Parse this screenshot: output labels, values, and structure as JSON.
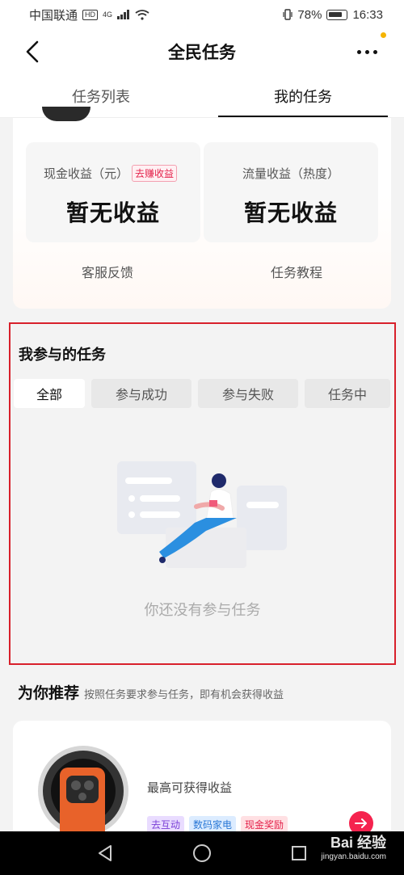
{
  "status_bar": {
    "carrier": "中国联通",
    "hd_badge": "HD",
    "network": "4G",
    "battery": "78%",
    "time": "16:33",
    "icons": [
      "signal-icon",
      "wifi-icon",
      "vibrate-icon",
      "battery-icon"
    ]
  },
  "header": {
    "title": "全民任务",
    "back_icon": "chevron-left-icon",
    "more_icon": "more-horizontal-icon"
  },
  "tabs": [
    {
      "label": "任务列表",
      "active": false
    },
    {
      "label": "我的任务",
      "active": true
    }
  ],
  "summary": {
    "cash": {
      "label": "现金收益（元）",
      "tag": "去赚收益",
      "value": "暂无收益"
    },
    "traffic": {
      "label": "流量收益（热度）",
      "value": "暂无收益"
    },
    "links": [
      "客服反馈",
      "任务教程"
    ]
  },
  "participated": {
    "title": "我参与的任务",
    "filters": [
      {
        "label": "全部",
        "active": true
      },
      {
        "label": "参与成功",
        "active": false
      },
      {
        "label": "参与失败",
        "active": false
      },
      {
        "label": "任务中",
        "active": false
      }
    ],
    "empty_text": "你还没有参与任务"
  },
  "recommend": {
    "title": "为你推荐",
    "subtitle": "按照任务要求参与任务，即有机会获得收益",
    "card": {
      "earn_label": "最高可获得收益",
      "tags": [
        "去互动",
        "数码家电",
        "现金奖励"
      ]
    }
  },
  "nav": {
    "icons": [
      "back-triangle-icon",
      "home-circle-icon",
      "recents-square-icon"
    ]
  },
  "watermark": {
    "text": "Bai 经验",
    "url": "jingyan.baidu.com"
  },
  "colors": {
    "accent": "#f5234e",
    "highlight_border": "#d8202b",
    "tag_pink": "#e4224b"
  }
}
